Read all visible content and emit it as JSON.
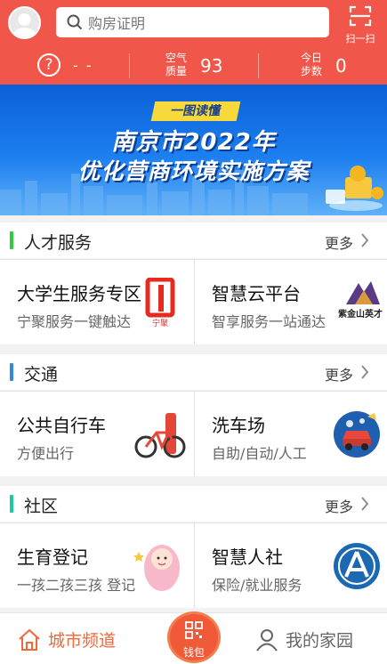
{
  "header": {
    "search_placeholder": "购房证明",
    "scan_label": "扫一扫",
    "status": {
      "unknown_value": "- -",
      "air_label_top": "空气",
      "air_label_bottom": "质量",
      "air_value": "93",
      "steps_label_top": "今日",
      "steps_label_bottom": "步数",
      "steps_value": "0"
    }
  },
  "banner": {
    "tag": "一图读懂",
    "line1": "南京市2022年",
    "line2": "优化营商环境实施方案"
  },
  "sections": [
    {
      "title": "人才服务",
      "more": "更多",
      "color": "#2ecc40",
      "items": [
        {
          "title": "大学生服务专区",
          "subtitle": "宁聚服务一键触达",
          "icon_text": "宁聚"
        },
        {
          "title": "智慧云平台",
          "subtitle": "智享服务一站通达",
          "icon_text": "紫金山英才"
        }
      ]
    },
    {
      "title": "交通",
      "more": "更多",
      "color": "#2f8ae0",
      "items": [
        {
          "title": "公共自行车",
          "subtitle": "方便出行"
        },
        {
          "title": "洗车场",
          "subtitle": "自助/自动/人工"
        }
      ]
    },
    {
      "title": "社区",
      "more": "更多",
      "color": "#1fc9a0",
      "items": [
        {
          "title": "生育登记",
          "subtitle": "一孩二孩三孩 登记"
        },
        {
          "title": "智慧人社",
          "subtitle": "保险/就业服务"
        }
      ]
    }
  ],
  "bottom_nav": {
    "city": "城市频道",
    "wallet": "钱包",
    "home": "我的家园"
  },
  "colors": {
    "header_bg": "#f0574a",
    "accent_orange": "#ef6a3a"
  }
}
